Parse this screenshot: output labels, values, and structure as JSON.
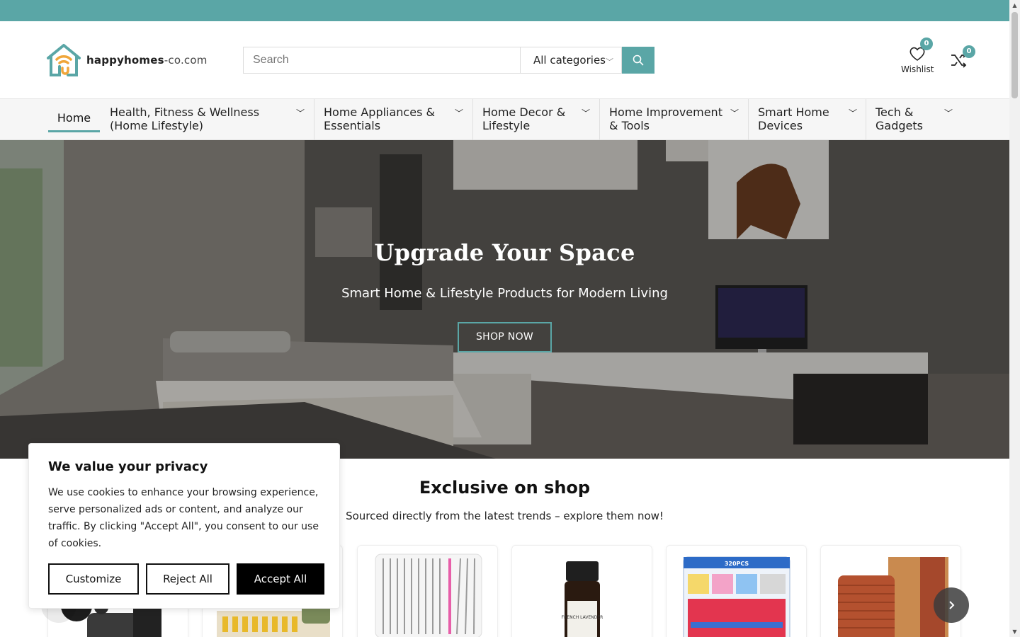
{
  "brand": {
    "name_bold": "happyhomes",
    "name_suffix": "-co.com"
  },
  "search": {
    "placeholder": "Search",
    "value": "",
    "category": "All categories"
  },
  "header": {
    "wishlist_label": "Wishlist",
    "wishlist_count": "0",
    "compare_count": "0"
  },
  "nav": {
    "home": "Home",
    "items": [
      {
        "label": "Health, Fitness & Wellness (Home Lifestyle)"
      },
      {
        "label": "Home Appliances & Essentials"
      },
      {
        "label": "Home Decor & Lifestyle"
      },
      {
        "label": "Home Improvement & Tools"
      },
      {
        "label": "Smart Home Devices"
      },
      {
        "label": "Tech & Gadgets"
      }
    ]
  },
  "hero": {
    "title": "Upgrade Your Space",
    "subtitle": "Smart Home & Lifestyle Products for Modern Living",
    "cta": "SHOP NOW"
  },
  "section": {
    "title": "Exclusive on shop",
    "subtitle": "Sourced directly from the latest trends – explore them now!"
  },
  "products": [
    {
      "icon": "massage-gun-product-image"
    },
    {
      "icon": "terminal-kit-product-image"
    },
    {
      "icon": "stainless-tools-product-image"
    },
    {
      "icon": "lavender-oil-product-image",
      "label": "FRENCH LAVENDER"
    },
    {
      "icon": "connector-kit-product-image",
      "label": "320PCS"
    },
    {
      "icon": "towel-set-product-image"
    }
  ],
  "cookie": {
    "title": "We value your privacy",
    "body": "We use cookies to enhance your browsing experience, serve personalized ads or content, and analyze our traffic. By clicking \"Accept All\", you consent to our use of cookies.",
    "customize": "Customize",
    "reject": "Reject All",
    "accept": "Accept All"
  },
  "colors": {
    "accent": "#5aa6a6",
    "logo_orange": "#f0a63a"
  }
}
